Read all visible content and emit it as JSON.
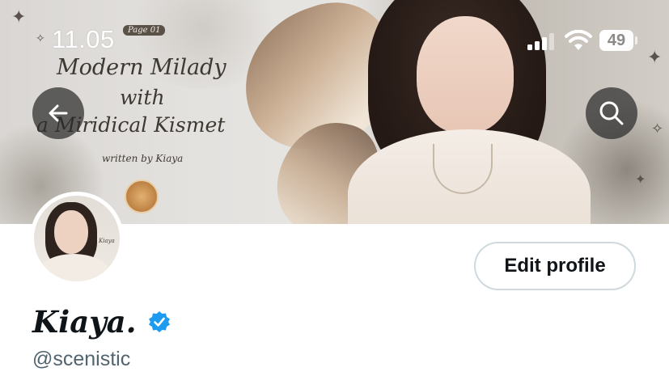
{
  "status_bar": {
    "time": "11.05",
    "battery": "49",
    "battery_level": 0.49
  },
  "banner": {
    "page_tag": "Page 01",
    "title_lines": [
      "Modern Milady",
      "with",
      "a Miridical Kismet"
    ],
    "byline": "written by Kiaya",
    "avatar_tag": "Kiaya"
  },
  "nav": {
    "back_icon": "arrow-left-icon",
    "search_icon": "search-icon"
  },
  "profile": {
    "edit_label": "Edit profile",
    "display_name": "Kiaya.",
    "handle": "@scenistic",
    "verified_color": "#1d9bf0"
  }
}
